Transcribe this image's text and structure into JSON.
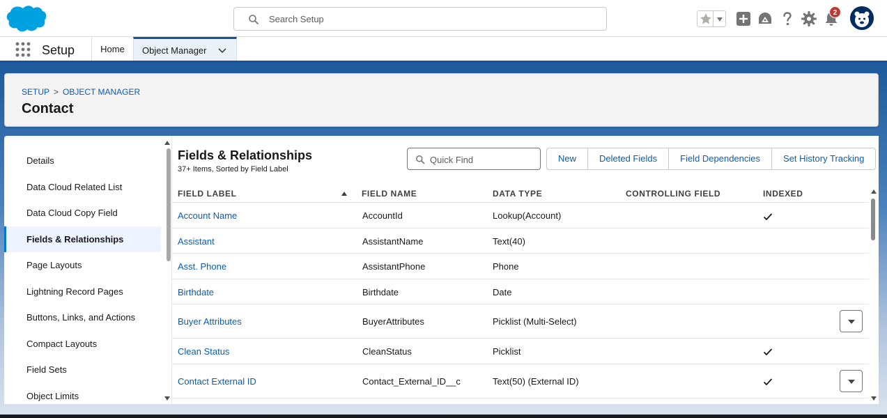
{
  "header": {
    "search_placeholder": "Search Setup",
    "notification_count": "2"
  },
  "context": {
    "app_name": "Setup",
    "tabs": [
      {
        "label": "Home"
      },
      {
        "label": "Object Manager"
      }
    ]
  },
  "page_header": {
    "breadcrumb": [
      "SETUP",
      "OBJECT MANAGER"
    ],
    "breadcrumb_separator": ">",
    "title": "Contact"
  },
  "left_nav": {
    "items": [
      {
        "label": "Details"
      },
      {
        "label": "Data Cloud Related List"
      },
      {
        "label": "Data Cloud Copy Field"
      },
      {
        "label": "Fields & Relationships"
      },
      {
        "label": "Page Layouts"
      },
      {
        "label": "Lightning Record Pages"
      },
      {
        "label": "Buttons, Links, and Actions"
      },
      {
        "label": "Compact Layouts"
      },
      {
        "label": "Field Sets"
      },
      {
        "label": "Object Limits"
      }
    ],
    "active_index": 3
  },
  "main": {
    "title": "Fields & Relationships",
    "subtitle": "37+ Items, Sorted by Field Label",
    "quick_find_placeholder": "Quick Find",
    "buttons": [
      "New",
      "Deleted Fields",
      "Field Dependencies",
      "Set History Tracking"
    ]
  },
  "table": {
    "columns": [
      "FIELD LABEL",
      "FIELD NAME",
      "DATA TYPE",
      "CONTROLLING FIELD",
      "INDEXED"
    ],
    "rows": [
      {
        "label": "Account Name",
        "name": "AccountId",
        "type": "Lookup(Account)",
        "controlling": "",
        "indexed": true,
        "menu": false
      },
      {
        "label": "Assistant",
        "name": "AssistantName",
        "type": "Text(40)",
        "controlling": "",
        "indexed": false,
        "menu": false
      },
      {
        "label": "Asst. Phone",
        "name": "AssistantPhone",
        "type": "Phone",
        "controlling": "",
        "indexed": false,
        "menu": false
      },
      {
        "label": "Birthdate",
        "name": "Birthdate",
        "type": "Date",
        "controlling": "",
        "indexed": false,
        "menu": false
      },
      {
        "label": "Buyer Attributes",
        "name": "BuyerAttributes",
        "type": "Picklist (Multi-Select)",
        "controlling": "",
        "indexed": false,
        "menu": true
      },
      {
        "label": "Clean Status",
        "name": "CleanStatus",
        "type": "Picklist",
        "controlling": "",
        "indexed": true,
        "menu": false
      },
      {
        "label": "Contact External ID",
        "name": "Contact_External_ID__c",
        "type": "Text(50) (External ID)",
        "controlling": "",
        "indexed": true,
        "menu": true
      }
    ]
  },
  "colors": {
    "brand_blue": "#1b5297",
    "link": "#0b5cab",
    "salesforce_cloud": "#00a1e0",
    "badge_red": "#c23934"
  },
  "icons": [
    "salesforce-logo",
    "search-icon",
    "star-icon",
    "chevron-down-icon",
    "add-icon",
    "trailhead-icon",
    "help-icon",
    "gear-icon",
    "bell-icon",
    "app-launcher-icon",
    "check-icon",
    "sort-up-icon"
  ]
}
